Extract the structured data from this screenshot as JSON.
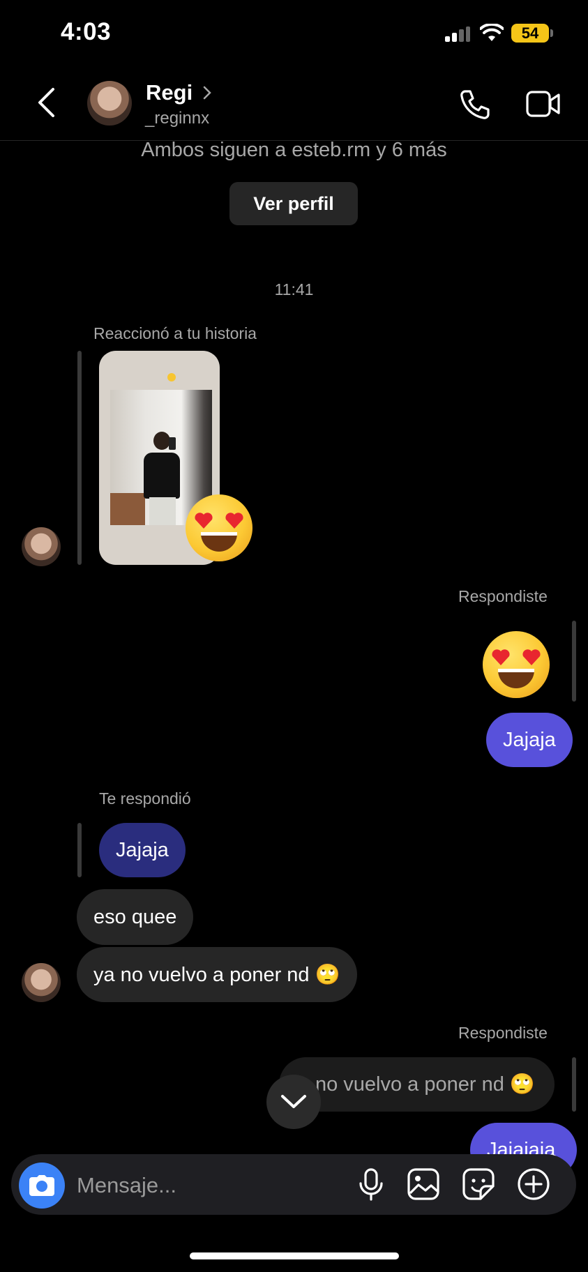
{
  "status_bar": {
    "time": "4:03",
    "battery": "54"
  },
  "header": {
    "contact_name": "Regi",
    "contact_handle": "_reginnx",
    "icons": [
      "back-icon",
      "chevron-right-icon",
      "phone-icon",
      "video-camera-icon"
    ]
  },
  "profile_intro": {
    "mutual_followers": "Ambos siguen a esteb.rm y 6 más",
    "view_profile_label": "Ver perfil"
  },
  "thread": {
    "timestamp": "11:41",
    "story_reaction": {
      "label": "Reaccionó a tu historia",
      "reaction_emoji": "heart-eyes"
    },
    "reply_1": {
      "label": "Respondiste",
      "emoji": "heart-eyes",
      "message": "Jajaja"
    },
    "reply_2": {
      "label": "Te respondió",
      "quoted_message": "Jajaja"
    },
    "incoming": [
      {
        "text": "eso quee"
      },
      {
        "text": "ya no vuelvo a poner nd 🙄"
      }
    ],
    "reply_3": {
      "label": "Respondiste",
      "quoted_message": "no vuelvo a poner nd 🙄",
      "message": "Jajajaja"
    }
  },
  "composer": {
    "placeholder": "Mensaje...",
    "icons": [
      "camera-icon",
      "microphone-icon",
      "gallery-icon",
      "sticker-icon",
      "plus-icon"
    ]
  },
  "colors": {
    "background": "#000000",
    "outgoing_bubble": "#5851DB",
    "incoming_bubble": "#262626",
    "camera_button": "#3B82F6",
    "battery": "#F5C518"
  }
}
